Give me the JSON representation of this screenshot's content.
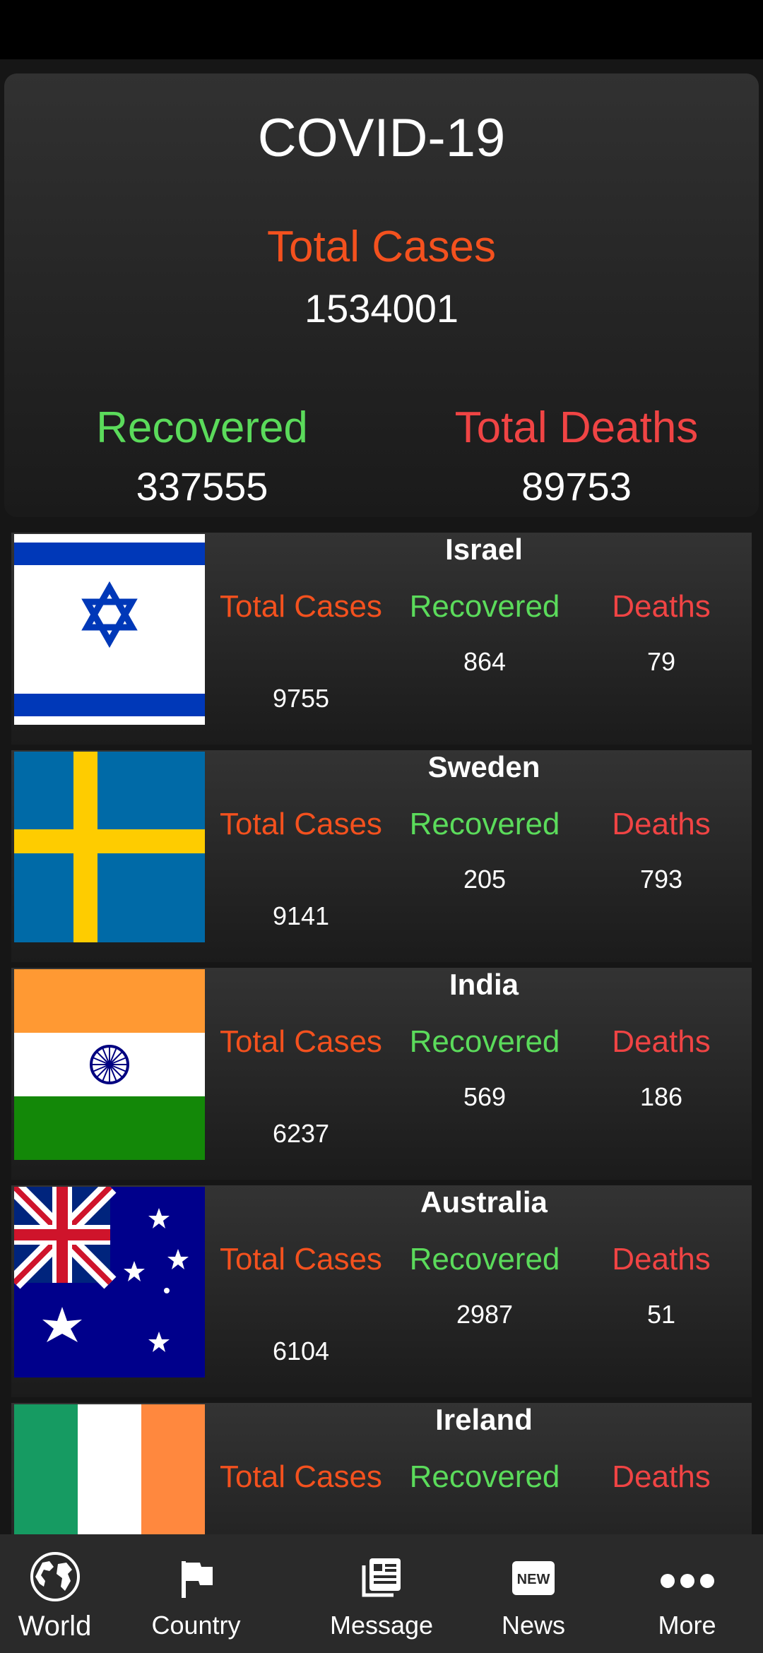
{
  "summary": {
    "title": "COVID-19",
    "total_label": "Total Cases",
    "total_value": "1534001",
    "recovered_label": "Recovered",
    "recovered_value": "337555",
    "deaths_label": "Total Deaths",
    "deaths_value": "89753"
  },
  "labels": {
    "cases": "Total Cases",
    "recovered": "Recovered",
    "deaths": "Deaths"
  },
  "countries": [
    {
      "name": "Israel",
      "cases": "9755",
      "recovered": "864",
      "deaths": "79",
      "flag": "israel-flag"
    },
    {
      "name": "Sweden",
      "cases": "9141",
      "recovered": "205",
      "deaths": "793",
      "flag": "sweden-flag"
    },
    {
      "name": "India",
      "cases": "6237",
      "recovered": "569",
      "deaths": "186",
      "flag": "india-flag"
    },
    {
      "name": "Australia",
      "cases": "6104",
      "recovered": "2987",
      "deaths": "51",
      "flag": "australia-flag"
    },
    {
      "name": "Ireland",
      "cases": "",
      "recovered": "",
      "deaths": "",
      "flag": "ireland-flag"
    }
  ],
  "nav": [
    {
      "label": "World",
      "icon": "globe-icon"
    },
    {
      "label": "Country",
      "icon": "flag-icon"
    },
    {
      "label": "Message",
      "icon": "message-icon"
    },
    {
      "label": "News",
      "icon": "news-icon"
    },
    {
      "label": "More",
      "icon": "more-icon"
    }
  ],
  "colors": {
    "total": "#F4511E",
    "recovered": "#5BDB5B",
    "deaths": "#F04444"
  }
}
